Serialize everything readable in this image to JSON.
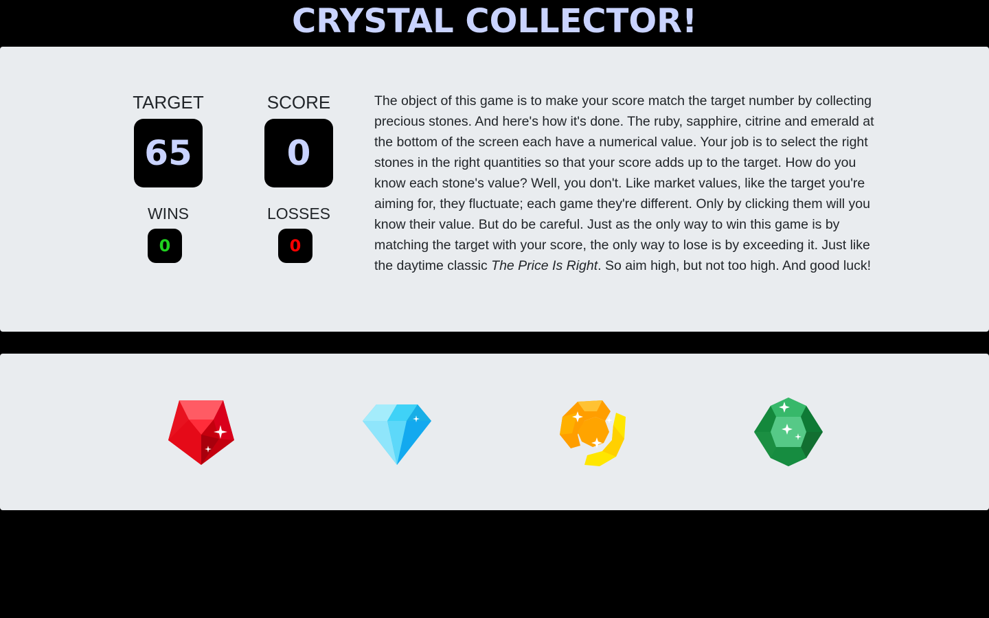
{
  "game": {
    "title": "CRYSTAL COLLECTOR!"
  },
  "stats": {
    "target_label": "TARGET",
    "target_value": "65",
    "score_label": "SCORE",
    "score_value": "0",
    "wins_label": "WINS",
    "wins_value": "0",
    "losses_label": "LOSSES",
    "losses_value": "0",
    "wins_color": "#1fd11f",
    "losses_color": "#ff0000"
  },
  "instructions": {
    "text_before": "The object of this game is to make your score match the target number by collecting precious stones. And here's how it's done. The ruby, sapphire, citrine and emerald at the bottom of the screen each have a numerical value. Your job is to select the right stones in the right quantities so that your score adds up to the target. How do you know each stone's value? Well, you don't. Like market values, like the target you're aiming for, they fluctuate; each game they're different. Only by clicking them will you know their value. But do be careful. Just as the only way to win this game is by matching the target with your score, the only way to lose is by exceeding it. Just like the daytime classic ",
    "text_emphasis": "The Price Is Right",
    "text_after": ". So aim high, but not too high. And good luck!"
  },
  "crystals": [
    {
      "name": "ruby",
      "icon": "ruby-icon",
      "color": "#e8121f"
    },
    {
      "name": "sapphire",
      "icon": "sapphire-icon",
      "color": "#27c4f0"
    },
    {
      "name": "citrine",
      "icon": "citrine-icon",
      "color": "#ffa600"
    },
    {
      "name": "emerald",
      "icon": "emerald-icon",
      "color": "#1fa14d"
    }
  ],
  "colors": {
    "background": "#000000",
    "panel": "#e9ecef",
    "title": "#c9d3ff",
    "box_text": "#c9d3ff"
  }
}
